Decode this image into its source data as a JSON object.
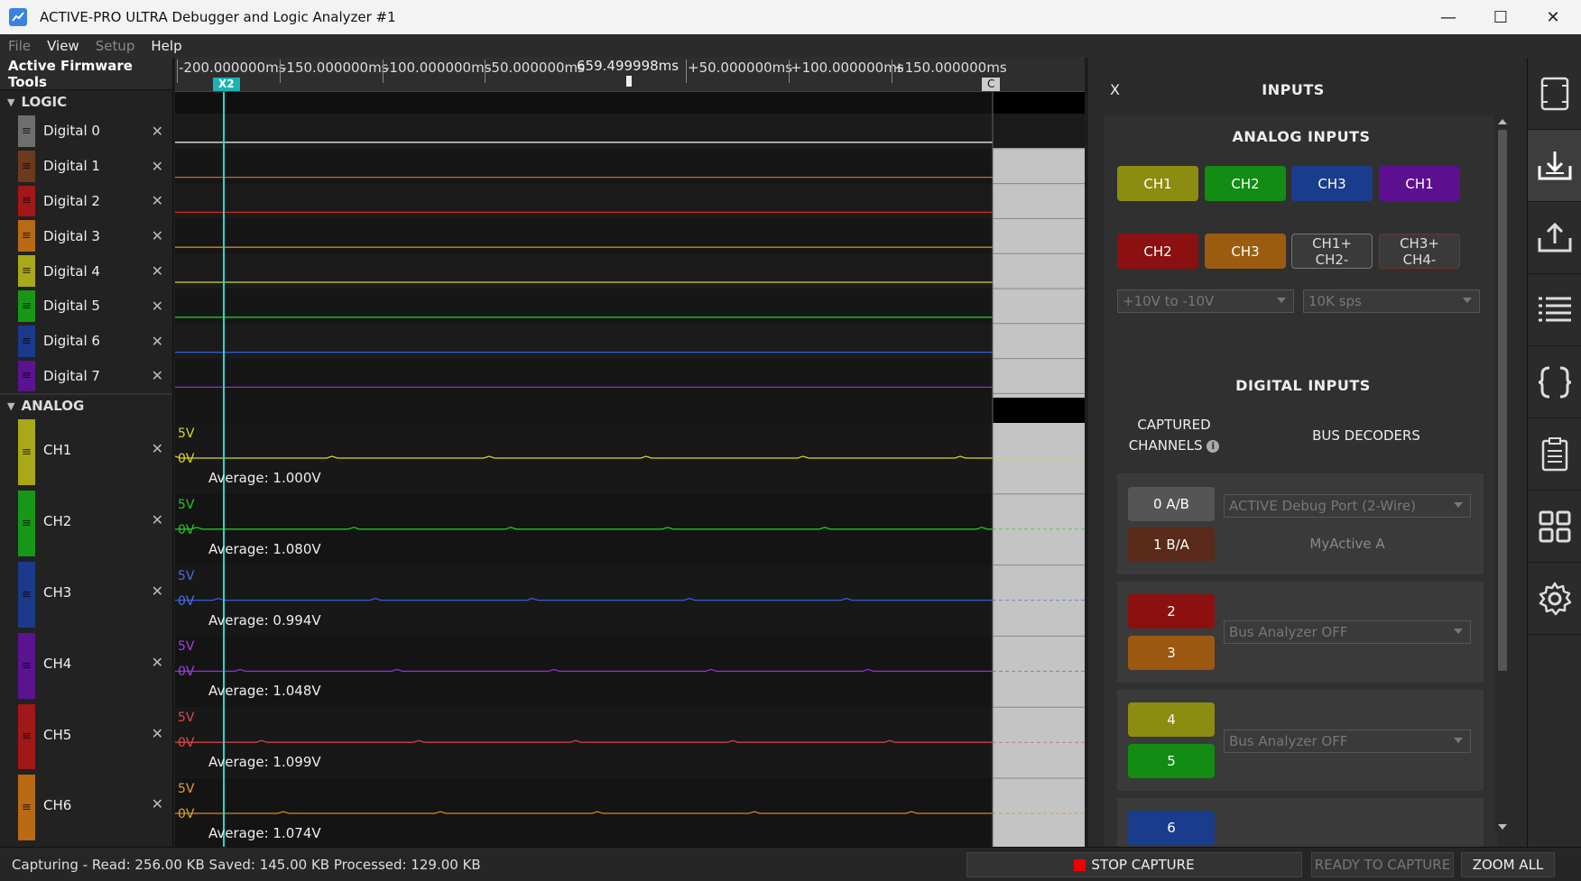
{
  "window": {
    "title": "ACTIVE-PRO ULTRA Debugger and Logic Analyzer #1",
    "minimize": "—",
    "maximize": "☐",
    "close": "✕"
  },
  "menu": [
    {
      "label": "File",
      "enabled": false
    },
    {
      "label": "View",
      "enabled": true
    },
    {
      "label": "Setup",
      "enabled": false
    },
    {
      "label": "Help",
      "enabled": true
    }
  ],
  "left_panel": {
    "header": "Active Firmware Tools",
    "logic_label": "LOGIC",
    "analog_label": "ANALOG",
    "close_glyph": "✕",
    "handle_glyph": "≡",
    "logic_channels": [
      {
        "name": "Digital 0",
        "color": "#6e6e6e"
      },
      {
        "name": "Digital 1",
        "color": "#6b3a1f"
      },
      {
        "name": "Digital 2",
        "color": "#a01818"
      },
      {
        "name": "Digital 3",
        "color": "#b86a14"
      },
      {
        "name": "Digital 4",
        "color": "#a8a818"
      },
      {
        "name": "Digital 5",
        "color": "#189618"
      },
      {
        "name": "Digital 6",
        "color": "#1c3a8c"
      },
      {
        "name": "Digital 7",
        "color": "#5a1490"
      }
    ],
    "analog_channels": [
      {
        "name": "CH1",
        "color": "#a8a818"
      },
      {
        "name": "CH2",
        "color": "#189618"
      },
      {
        "name": "CH3",
        "color": "#1c3a8c"
      },
      {
        "name": "CH4",
        "color": "#5a1490"
      },
      {
        "name": "CH5",
        "color": "#a01818"
      },
      {
        "name": "CH6",
        "color": "#b86a14"
      }
    ]
  },
  "ruler": {
    "ticks": [
      "-200.000000ms",
      "-150.000000ms",
      "-100.000000ms",
      "-50.000000ms",
      "+50.000000ms",
      "+100.000000ms",
      "+150.000000ms"
    ],
    "cursor_readout": "659.499998ms",
    "marker_x2": "X2",
    "marker_c": "C"
  },
  "plot": {
    "digital_trace_colors": [
      "#e6e6e6",
      "#c26a22",
      "#d02828",
      "#d08a20",
      "#d8d820",
      "#20c820",
      "#3060d8",
      "#9030d0"
    ],
    "analog": [
      {
        "top_label": "5V",
        "zero_label": "0V",
        "average": "Average: 1.000V",
        "color": "#d8d820",
        "label_color": "#d8d820"
      },
      {
        "top_label": "5V",
        "zero_label": "0V",
        "average": "Average: 1.080V",
        "color": "#20c820",
        "label_color": "#20c820"
      },
      {
        "top_label": "5V",
        "zero_label": "0V",
        "average": "Average: 0.994V",
        "color": "#3060d8",
        "label_color": "#4a6ee0"
      },
      {
        "top_label": "5V",
        "zero_label": "0V",
        "average": "Average: 1.048V",
        "color": "#9030d0",
        "label_color": "#a040e0"
      },
      {
        "top_label": "5V",
        "zero_label": "0V",
        "average": "Average: 1.099V",
        "color": "#d04040",
        "label_color": "#e04848"
      },
      {
        "top_label": "5V",
        "zero_label": "0V",
        "average": "Average: 1.074V",
        "color": "#d08a20",
        "label_color": "#e0a028"
      }
    ]
  },
  "inputs": {
    "close": "X",
    "title": "INPUTS",
    "analog_heading": "ANALOG INPUTS",
    "analog_buttons_row1": [
      {
        "label": "CH1",
        "color": "#8c8c10"
      },
      {
        "label": "CH2",
        "color": "#128c12"
      },
      {
        "label": "CH3",
        "color": "#1a3c8c"
      },
      {
        "label": "CH1",
        "color": "#5c1090"
      }
    ],
    "analog_buttons_row2": [
      {
        "label": "CH2",
        "color": "#8c1010"
      },
      {
        "label": "CH3",
        "color": "#9c5c10"
      },
      {
        "label_line1": "CH1+",
        "label_line2": "CH2-"
      },
      {
        "label_line1": "CH3+",
        "label_line2": "CH4-"
      }
    ],
    "range_dropdown": "+10V to -10V",
    "rate_dropdown": "10K sps",
    "digital_heading": "DIGITAL INPUTS",
    "captured_channels_line1": "CAPTURED",
    "captured_channels_line2": "CHANNELS",
    "info_glyph": "i",
    "bus_decoders": "BUS DECODERS",
    "groups": [
      {
        "pill1": "0 A/B",
        "pill1_color": "#555555",
        "pill2": "1 B/A",
        "pill2_color": "#5a2a1a",
        "dropdown": "ACTIVE Debug Port (2-Wire)",
        "subtext": "MyActive A"
      },
      {
        "pill1": "2",
        "pill1_color": "#8c1010",
        "pill2": "3",
        "pill2_color": "#9c5810",
        "dropdown": "Bus Analyzer OFF",
        "subtext": ""
      },
      {
        "pill1": "4",
        "pill1_color": "#8c8c10",
        "pill2": "5",
        "pill2_color": "#128c12",
        "dropdown": "Bus Analyzer OFF",
        "subtext": ""
      },
      {
        "pill1": "6",
        "pill1_color": "#1a3c8c",
        "pill2": "",
        "pill2_color": "#5c1090",
        "dropdown": "",
        "subtext": ""
      }
    ]
  },
  "toolbar": [
    "screen-icon",
    "import-icon",
    "export-icon",
    "list-icon",
    "braces-icon",
    "notes-icon",
    "grid-icon",
    "gear-icon"
  ],
  "status": {
    "text": "Capturing - Read: 256.00 KB Saved: 145.00 KB Processed: 129.00 KB",
    "stop_capture": "STOP CAPTURE",
    "ready_to_capture": "READY TO CAPTURE",
    "zoom_all": "ZOOM ALL"
  }
}
